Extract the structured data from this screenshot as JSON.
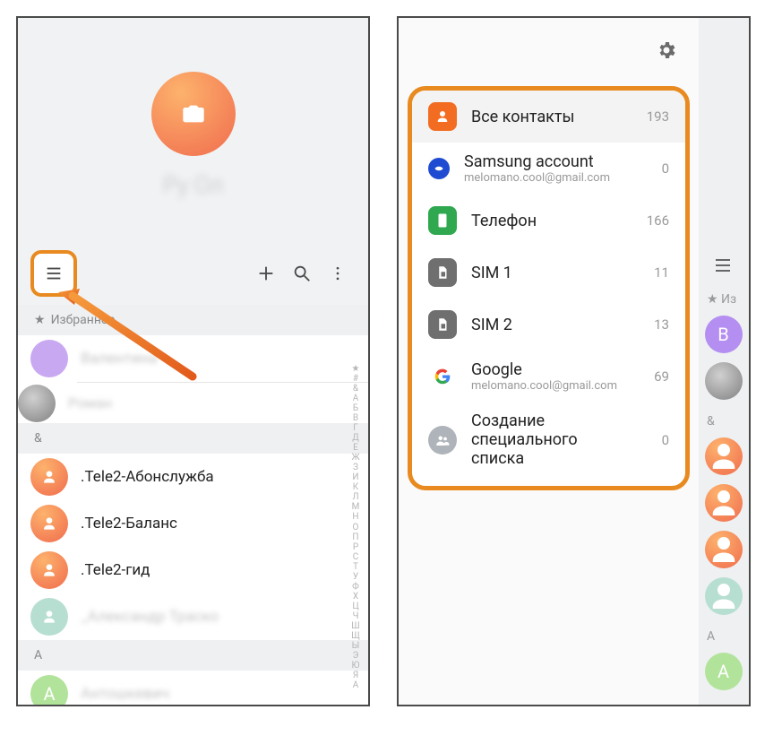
{
  "left": {
    "hero_name": "Ру Ол",
    "favorites_header": "Избранное",
    "favorites": [
      {
        "name": "Валентина"
      },
      {
        "name": "Роман"
      }
    ],
    "sections": [
      {
        "letter": "&",
        "rows": [
          {
            "name": ".Tele2-Абонслужба",
            "avatar": "orange"
          },
          {
            "name": ".Tele2-Баланс",
            "avatar": "orange"
          },
          {
            "name": ".Tele2-гид",
            "avatar": "orange"
          },
          {
            "name": "_Александр Траско",
            "avatar": "teal",
            "blurred": true
          }
        ]
      },
      {
        "letter": "A",
        "rows": [
          {
            "name": "Антошкевич",
            "avatar": "green",
            "initial": "A",
            "blurred": true
          }
        ]
      }
    ],
    "index_rail": [
      "★",
      "#",
      "&",
      "А",
      "Б",
      "В",
      "Г",
      "Д",
      "Е",
      "Ж",
      "З",
      "И",
      "К",
      "Л",
      "М",
      "Н",
      "О",
      "П",
      "Р",
      "С",
      "Т",
      "У",
      "Ф",
      "Х",
      "Ц",
      "Ч",
      "Ш",
      "Щ",
      "Ы",
      "Э",
      "Ю",
      "Я",
      "A"
    ]
  },
  "right": {
    "sources": [
      {
        "id": "all",
        "title": "Все контакты",
        "sub": "",
        "count": "193",
        "icon": "person",
        "variant": "orange",
        "selected": true
      },
      {
        "id": "samsung",
        "title": "Samsung account",
        "sub": "melomano.cool@gmail.com",
        "count": "0",
        "icon": "samsung",
        "variant": "blue"
      },
      {
        "id": "phone",
        "title": "Телефон",
        "sub": "",
        "count": "166",
        "icon": "phone",
        "variant": "green"
      },
      {
        "id": "sim1",
        "title": "SIM 1",
        "sub": "",
        "count": "11",
        "icon": "sim",
        "variant": "grey"
      },
      {
        "id": "sim2",
        "title": "SIM 2",
        "sub": "",
        "count": "13",
        "icon": "sim",
        "variant": "grey"
      },
      {
        "id": "google",
        "title": "Google",
        "sub": "melomano.cool@gmail.com",
        "count": "69",
        "icon": "google",
        "variant": "google"
      },
      {
        "id": "custom",
        "title": "Создание специального списка",
        "sub": "",
        "count": "0",
        "icon": "group",
        "variant": "light"
      }
    ],
    "peek": {
      "favorites_label": "Из",
      "section_amp": "&",
      "section_A": "A",
      "items": [
        {
          "type": "letter",
          "initial": "В",
          "color": "#b48ef0"
        },
        {
          "type": "photo"
        }
      ],
      "orange_count": 3,
      "letter_A_initial": "A"
    }
  }
}
